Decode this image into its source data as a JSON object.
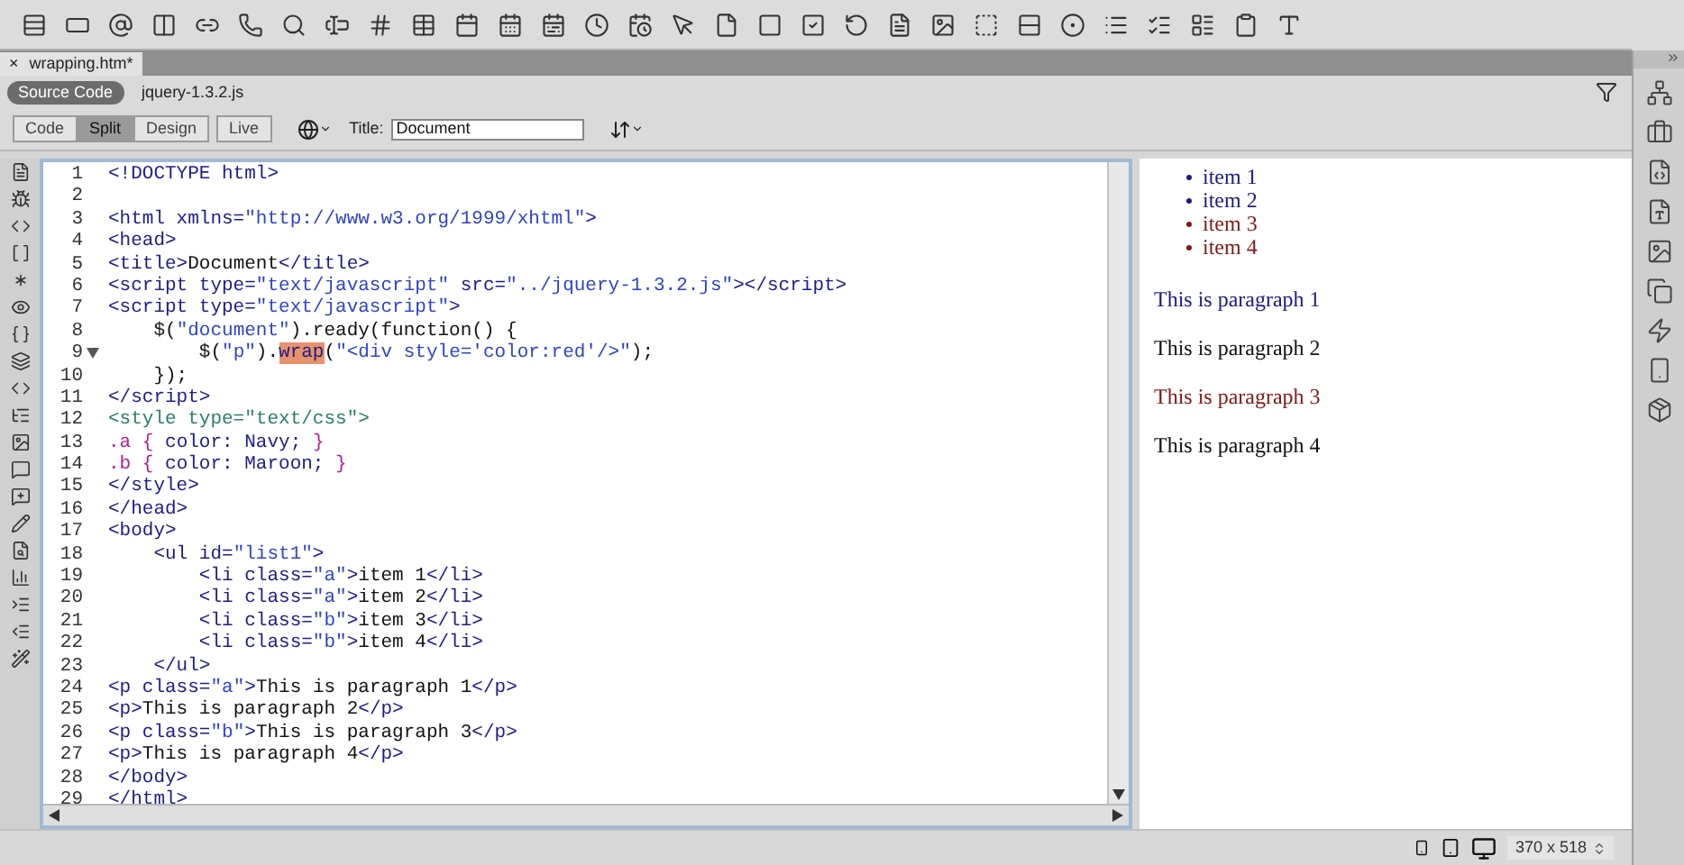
{
  "document_tab": {
    "close": "×",
    "title": "wrapping.htm*"
  },
  "related_files": [
    {
      "label": "Source Code",
      "selected": true
    },
    {
      "label": "jquery-1.3.2.js",
      "selected": false
    }
  ],
  "view_buttons": [
    {
      "label": "Code",
      "selected": false
    },
    {
      "label": "Split",
      "selected": true
    },
    {
      "label": "Design",
      "selected": false
    },
    {
      "label": "Live",
      "selected": false
    }
  ],
  "title_field": {
    "label": "Title:",
    "value": "Document"
  },
  "code": [
    {
      "number": "1",
      "fold": false,
      "tokens": [
        {
          "kind": "tag",
          "text": "<!DOCTYPE html>"
        }
      ]
    },
    {
      "number": "2",
      "fold": false
    },
    {
      "number": "3",
      "fold": false,
      "tokens": [
        {
          "kind": "tag",
          "text": "<html xmlns="
        },
        {
          "kind": "value",
          "text": "\"http://www.w3.org/1999/xhtml\""
        },
        {
          "kind": "tag",
          "text": ">"
        }
      ]
    },
    {
      "number": "4",
      "fold": false,
      "tokens": [
        {
          "kind": "tag",
          "text": "<head>"
        }
      ]
    },
    {
      "number": "5",
      "fold": false,
      "tokens": [
        {
          "kind": "tag",
          "text": "<title>"
        },
        {
          "kind": "text",
          "text": "Document"
        },
        {
          "kind": "tag",
          "text": "</title>"
        }
      ]
    },
    {
      "number": "6",
      "fold": false,
      "tokens": [
        {
          "kind": "tag",
          "text": "<script type="
        },
        {
          "kind": "value",
          "text": "\"text/javascript\""
        },
        {
          "kind": "tag",
          "text": " src="
        },
        {
          "kind": "value",
          "text": "\"../jquery-1.3.2.js\""
        },
        {
          "kind": "tag",
          "text": "></script>"
        }
      ]
    },
    {
      "number": "7",
      "fold": false,
      "tokens": [
        {
          "kind": "tag",
          "text": "<script type="
        },
        {
          "kind": "value",
          "text": "\"text/javascript\""
        },
        {
          "kind": "tag",
          "text": ">"
        }
      ]
    },
    {
      "number": "8",
      "fold": false,
      "tokens": [
        {
          "kind": "text",
          "text": "    $("
        },
        {
          "kind": "value",
          "text": "\"document\""
        },
        {
          "kind": "text",
          "text": ").ready(function() {"
        }
      ]
    },
    {
      "number": "9",
      "fold": true,
      "tokens": [
        {
          "kind": "text",
          "text": "        $("
        },
        {
          "kind": "value",
          "text": "\"p\""
        },
        {
          "kind": "text",
          "text": ")."
        },
        {
          "kind": "match",
          "text": "wrap"
        },
        {
          "kind": "text",
          "text": "("
        },
        {
          "kind": "value",
          "text": "\"<div style='color:red'/>\""
        },
        {
          "kind": "text",
          "text": ");"
        }
      ]
    },
    {
      "number": "10",
      "fold": false,
      "tokens": [
        {
          "kind": "text",
          "text": "    });"
        }
      ]
    },
    {
      "number": "11",
      "fold": false,
      "tokens": [
        {
          "kind": "tag",
          "text": "</script>"
        }
      ]
    },
    {
      "number": "12",
      "fold": false,
      "tokens": [
        {
          "kind": "style",
          "text": "<style type=\"text/css\">"
        }
      ]
    },
    {
      "number": "13",
      "fold": false,
      "tokens": [
        {
          "kind": "css",
          "text": ".a { "
        },
        {
          "kind": "prop",
          "text": "color: Navy;"
        },
        {
          "kind": "css",
          "text": " }"
        }
      ]
    },
    {
      "number": "14",
      "fold": false,
      "tokens": [
        {
          "kind": "css",
          "text": ".b { "
        },
        {
          "kind": "prop",
          "text": "color: Maroon;"
        },
        {
          "kind": "css",
          "text": " }"
        }
      ]
    },
    {
      "number": "15",
      "fold": false,
      "tokens": [
        {
          "kind": "tag",
          "text": "</style>"
        }
      ]
    },
    {
      "number": "16",
      "fold": false,
      "tokens": [
        {
          "kind": "tag",
          "text": "</head>"
        }
      ]
    },
    {
      "number": "17",
      "fold": false,
      "tokens": [
        {
          "kind": "tag",
          "text": "<body>"
        }
      ]
    },
    {
      "number": "18",
      "fold": false,
      "tokens": [
        {
          "kind": "tag",
          "text": "    <ul id="
        },
        {
          "kind": "value",
          "text": "\"list1\""
        },
        {
          "kind": "tag",
          "text": ">"
        }
      ]
    },
    {
      "number": "19",
      "fold": false,
      "tokens": [
        {
          "kind": "tag",
          "text": "        <li class="
        },
        {
          "kind": "value",
          "text": "\"a\""
        },
        {
          "kind": "tag",
          "text": ">"
        },
        {
          "kind": "text",
          "text": "item 1"
        },
        {
          "kind": "tag",
          "text": "</li>"
        }
      ]
    },
    {
      "number": "20",
      "fold": false,
      "tokens": [
        {
          "kind": "tag",
          "text": "        <li class="
        },
        {
          "kind": "value",
          "text": "\"a\""
        },
        {
          "kind": "tag",
          "text": ">"
        },
        {
          "kind": "text",
          "text": "item 2"
        },
        {
          "kind": "tag",
          "text": "</li>"
        }
      ]
    },
    {
      "number": "21",
      "fold": false,
      "tokens": [
        {
          "kind": "tag",
          "text": "        <li class="
        },
        {
          "kind": "value",
          "text": "\"b\""
        },
        {
          "kind": "tag",
          "text": ">"
        },
        {
          "kind": "text",
          "text": "item 3"
        },
        {
          "kind": "tag",
          "text": "</li>"
        }
      ]
    },
    {
      "number": "22",
      "fold": false,
      "tokens": [
        {
          "kind": "tag",
          "text": "        <li class="
        },
        {
          "kind": "value",
          "text": "\"b\""
        },
        {
          "kind": "tag",
          "text": ">"
        },
        {
          "kind": "text",
          "text": "item 4"
        },
        {
          "kind": "tag",
          "text": "</li>"
        }
      ]
    },
    {
      "number": "23",
      "fold": false,
      "tokens": [
        {
          "kind": "tag",
          "text": "    </ul>"
        }
      ]
    },
    {
      "number": "24",
      "fold": false,
      "tokens": [
        {
          "kind": "tag",
          "text": "<p class="
        },
        {
          "kind": "value",
          "text": "\"a\""
        },
        {
          "kind": "tag",
          "text": ">"
        },
        {
          "kind": "text",
          "text": "This is paragraph 1"
        },
        {
          "kind": "tag",
          "text": "</p>"
        }
      ]
    },
    {
      "number": "25",
      "fold": false,
      "tokens": [
        {
          "kind": "tag",
          "text": "<p>"
        },
        {
          "kind": "text",
          "text": "This is paragraph 2"
        },
        {
          "kind": "tag",
          "text": "</p>"
        }
      ]
    },
    {
      "number": "26",
      "fold": false,
      "tokens": [
        {
          "kind": "tag",
          "text": "<p class="
        },
        {
          "kind": "value",
          "text": "\"b\""
        },
        {
          "kind": "tag",
          "text": ">"
        },
        {
          "kind": "text",
          "text": "This is paragraph 3"
        },
        {
          "kind": "tag",
          "text": "</p>"
        }
      ]
    },
    {
      "number": "27",
      "fold": false,
      "tokens": [
        {
          "kind": "tag",
          "text": "<p>"
        },
        {
          "kind": "text",
          "text": "This is paragraph 4"
        },
        {
          "kind": "tag",
          "text": "</p>"
        }
      ]
    },
    {
      "number": "28",
      "fold": false,
      "tokens": [
        {
          "kind": "tag",
          "text": "</body>"
        }
      ]
    },
    {
      "number": "29",
      "fold": false,
      "tokens": [
        {
          "kind": "tag",
          "text": "</html>"
        }
      ]
    }
  ],
  "preview": {
    "list_items": [
      {
        "text": "item 1",
        "color": "#1c1c80"
      },
      {
        "text": "item 2",
        "color": "#1c1c80"
      },
      {
        "text": "item 3",
        "color": "#801818"
      },
      {
        "text": "item 4",
        "color": "#801818"
      }
    ],
    "paragraphs": [
      {
        "text": "This is paragraph 1",
        "color": "#1c1c80"
      },
      {
        "text": "This is paragraph 2",
        "color": "#111111"
      },
      {
        "text": "This is paragraph 3",
        "color": "#801818"
      },
      {
        "text": "This is paragraph 4",
        "color": "#111111"
      }
    ]
  },
  "status_bar": {
    "window_size": "370 x 518"
  }
}
